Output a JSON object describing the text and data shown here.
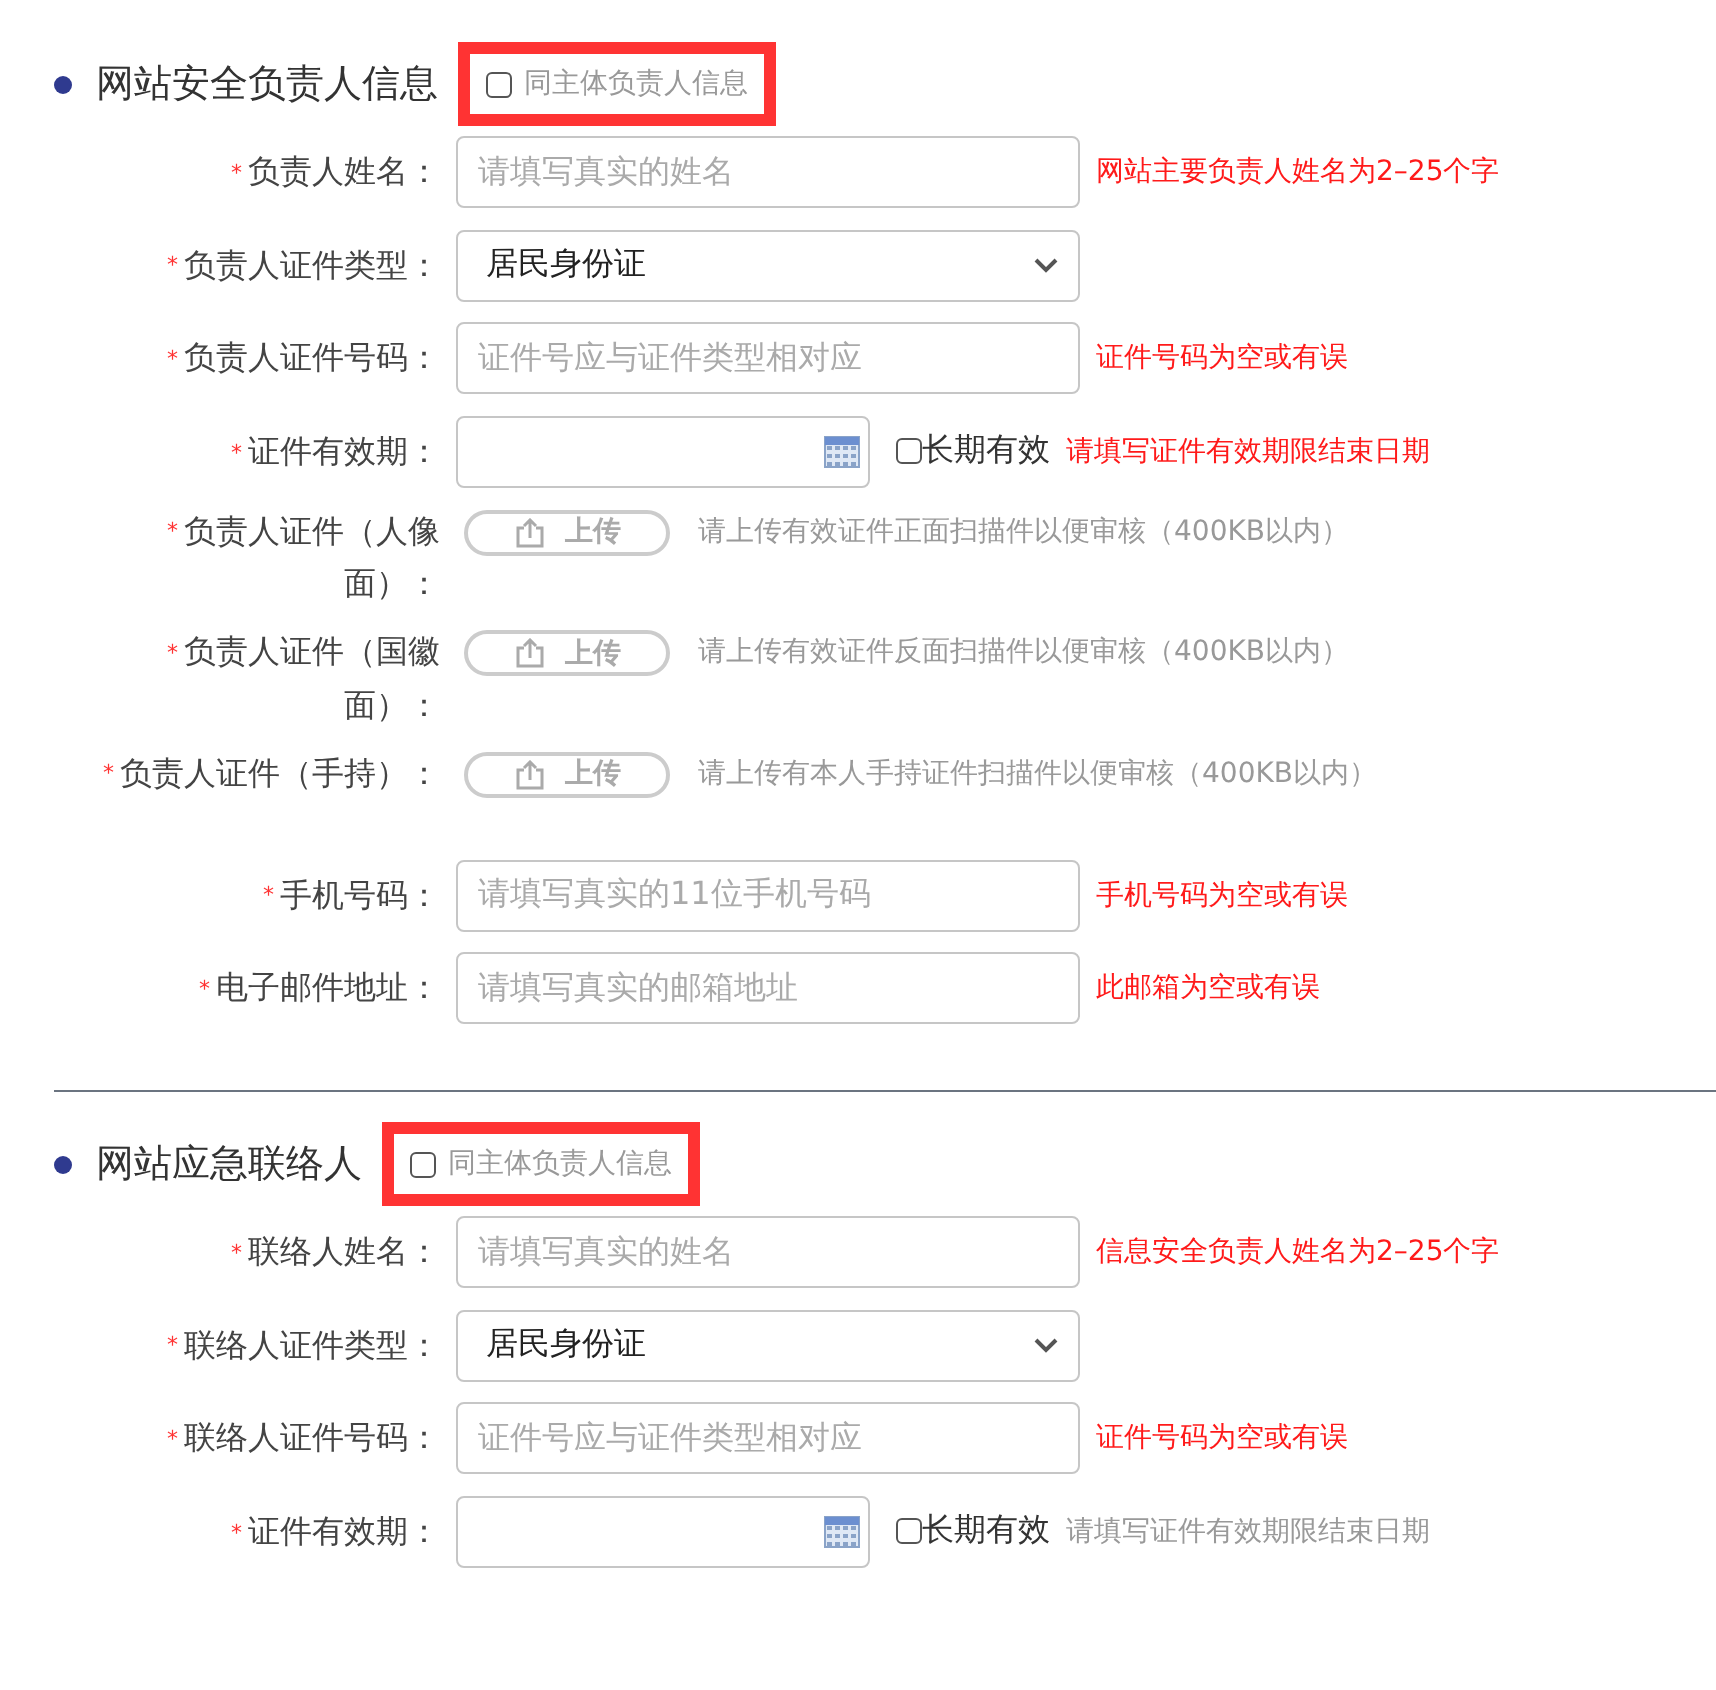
{
  "sections": [
    {
      "title": "网站安全负责人信息",
      "same_as_owner": {
        "label": "同主体负责人信息",
        "checked": false,
        "highlighted": true
      },
      "fields": [
        {
          "kind": "text",
          "required_mark": "*",
          "label": "负责人姓名：",
          "placeholder": "请填写真实的姓名",
          "hint": {
            "text": "网站主要负责人姓名为2–25个字",
            "error": true
          }
        },
        {
          "kind": "select",
          "required_mark": "*",
          "label": "负责人证件类型：",
          "value": "居民身份证"
        },
        {
          "kind": "text",
          "required_mark": "*",
          "label": "负责人证件号码：",
          "placeholder": "证件号应与证件类型相对应",
          "hint": {
            "text": "证件号码为空或有误",
            "error": true
          }
        },
        {
          "kind": "date",
          "required_mark": "*",
          "label": "证件有效期：",
          "long_term": {
            "label": "长期有效",
            "checked": false
          },
          "hint": {
            "text": "请填写证件有效期限结束日期",
            "error": true
          }
        },
        {
          "kind": "upload",
          "required_mark": "*",
          "label": "负责人证件（人像面）：",
          "button": "上传",
          "hint": {
            "text": "请上传有效证件正面扫描件以便审核（400KB以内）",
            "error": false
          }
        },
        {
          "kind": "upload",
          "required_mark": "*",
          "label": "负责人证件（国徽面）：",
          "button": "上传",
          "hint": {
            "text": "请上传有效证件反面扫描件以便审核（400KB以内）",
            "error": false
          }
        },
        {
          "kind": "upload",
          "required_mark": "*",
          "label": "负责人证件（手持）：",
          "button": "上传",
          "hint": {
            "text": "请上传有本人手持证件扫描件以便审核（400KB以内）",
            "error": false
          }
        },
        {
          "kind": "text",
          "required_mark": "*",
          "label": "手机号码：",
          "placeholder": "请填写真实的11位手机号码",
          "hint": {
            "text": "手机号码为空或有误",
            "error": true
          }
        },
        {
          "kind": "text",
          "required_mark": "*",
          "label": "电子邮件地址：",
          "placeholder": "请填写真实的邮箱地址",
          "hint": {
            "text": "此邮箱为空或有误",
            "error": true
          }
        }
      ]
    },
    {
      "title": "网站应急联络人",
      "same_as_owner": {
        "label": "同主体负责人信息",
        "checked": false,
        "highlighted": true
      },
      "fields": [
        {
          "kind": "text",
          "required_mark": "*",
          "label": "联络人姓名：",
          "placeholder": "请填写真实的姓名",
          "hint": {
            "text": "信息安全负责人姓名为2–25个字",
            "error": true
          }
        },
        {
          "kind": "select",
          "required_mark": "*",
          "label": "联络人证件类型：",
          "value": "居民身份证"
        },
        {
          "kind": "text",
          "required_mark": "*",
          "label": "联络人证件号码：",
          "placeholder": "证件号应与证件类型相对应",
          "hint": {
            "text": "证件号码为空或有误",
            "error": true
          }
        },
        {
          "kind": "date",
          "required_mark": "*",
          "label": "证件有效期：",
          "long_term": {
            "label": "长期有效",
            "checked": false
          },
          "hint": {
            "text": "请填写证件有效期限结束日期",
            "error": false
          }
        }
      ]
    }
  ]
}
